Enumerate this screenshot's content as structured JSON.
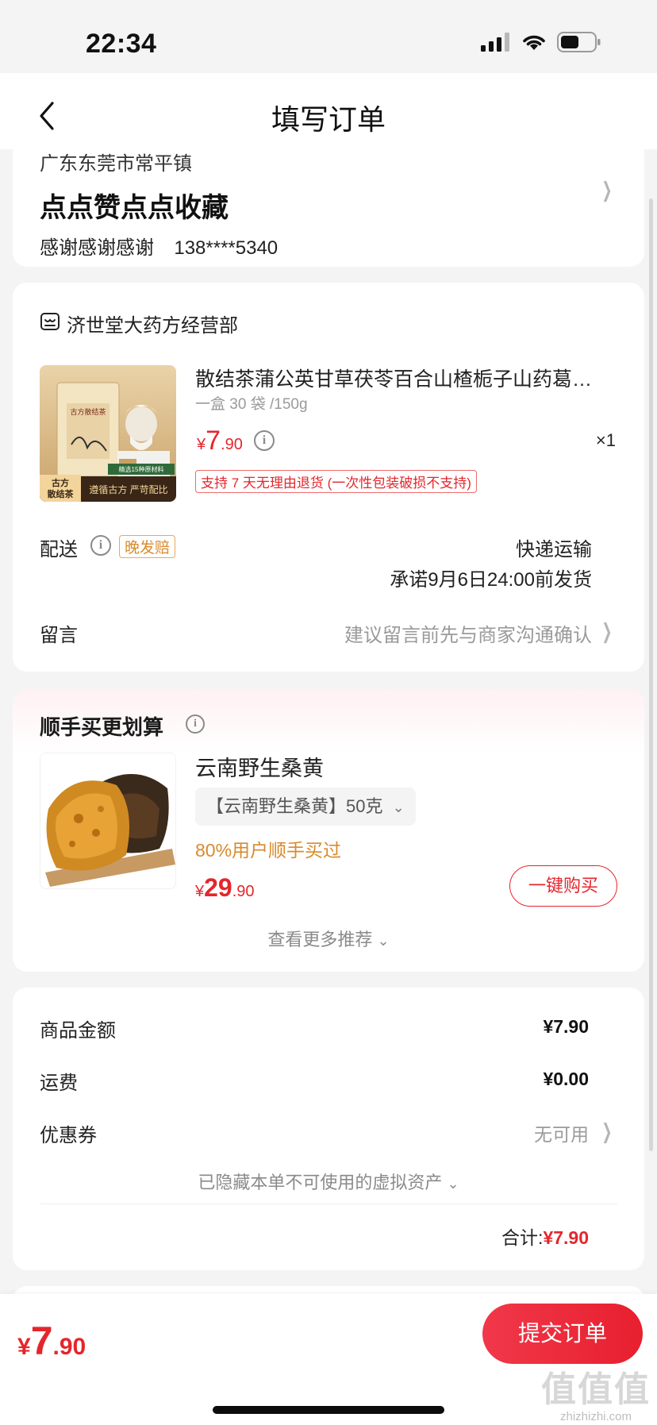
{
  "status_bar": {
    "time": "22:34"
  },
  "nav": {
    "title": "填写订单"
  },
  "address": {
    "region": "广东东莞市常平镇",
    "name": "点点赞点点收藏",
    "contact_name": "感谢感谢感谢",
    "phone": "138****5340"
  },
  "shop": {
    "name": "济世堂大药方经营部",
    "product": {
      "title": "散结茶蒲公英甘草茯苓百合山楂栀子山药葛…",
      "spec": "一盒 30 袋 /150g",
      "price_symbol": "¥",
      "price_int": "7",
      "price_dec": ".90",
      "qty": "×1",
      "return_policy": "支持 7 天无理由退货 (一次性包装破损不支持)",
      "image_badge_1": "古方",
      "image_badge_2": "散结茶",
      "image_caption": "遵循古方 严苛配比",
      "image_box_text": "古方散结茶",
      "image_top_label": "精选15种原材料"
    },
    "delivery_label": "配送",
    "late_tag": "晚发赔",
    "delivery_method": "快递运输",
    "delivery_promise": "承诺9月6日24:00前发货",
    "note_label": "留言",
    "note_placeholder": "建议留言前先与商家沟通确认"
  },
  "recommend": {
    "title": "顺手买更划算",
    "item": {
      "name": "云南野生桑黄",
      "spec": "【云南野生桑黄】50克",
      "social": "80%用户顺手买过",
      "price_symbol": "¥",
      "price_int": "29",
      "price_dec": ".90",
      "buy_label": "一键购买"
    },
    "more_label": "查看更多推荐"
  },
  "summary": {
    "goods_label": "商品金额",
    "goods_value": "¥7.90",
    "shipping_label": "运费",
    "shipping_value": "¥0.00",
    "coupon_label": "优惠券",
    "coupon_value": "无可用",
    "hidden_assets": "已隐藏本单不可使用的虚拟资产",
    "total_label": "合计:",
    "total_value": "¥7.90"
  },
  "bottom": {
    "price_symbol": "¥",
    "price_int": "7",
    "price_dec": ".90",
    "submit_label": "提交订单"
  },
  "watermark": {
    "big": "值值值",
    "small": "zhizhizhi.com"
  },
  "colors": {
    "accent": "#e4262c",
    "orange": "#d98a2b",
    "muted": "#9a9a9a"
  }
}
